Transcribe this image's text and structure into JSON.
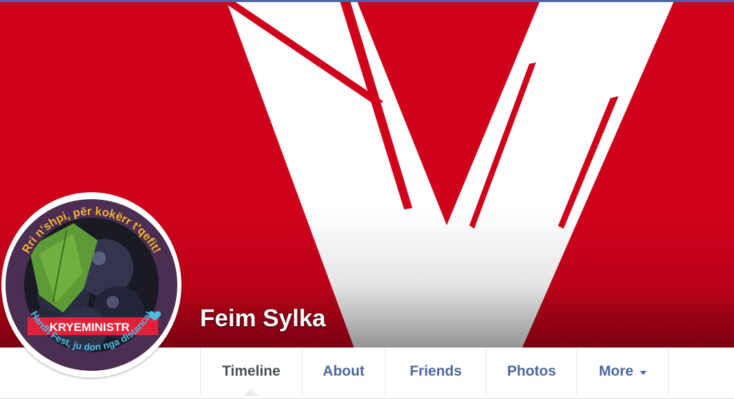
{
  "colors": {
    "cover_red": "#d0021b",
    "cover_white": "#ffffff",
    "link_blue": "#4b67a1",
    "active_tab_text": "#4b4f56",
    "avatar_ring": "#4b2e52",
    "avatar_ribbon": "#e0213a",
    "avatar_text_top": "#f2b233",
    "avatar_text_bottom": "#4dbbe0"
  },
  "profile": {
    "name": "Feim Sylka"
  },
  "avatar": {
    "top_text": "Rri n'shpi, për kokërr t'qefit!",
    "ribbon_text": "KRYEMINISTR",
    "bottom_text": "Hardh Fest, ju don nga distanca!",
    "heart_icon": "heart-icon"
  },
  "nav": {
    "tabs": [
      {
        "label": "Timeline",
        "active": true
      },
      {
        "label": "About"
      },
      {
        "label": "Friends"
      },
      {
        "label": "Photos"
      },
      {
        "label": "More",
        "icon": "caret-down-icon"
      }
    ]
  }
}
